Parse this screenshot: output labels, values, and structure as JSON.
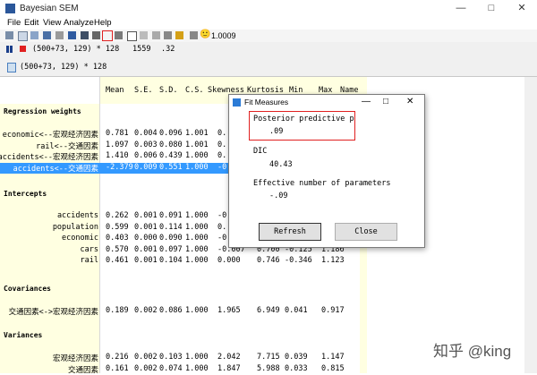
{
  "window": {
    "title": "Bayesian SEM",
    "min": "—",
    "max": "□",
    "close": "✕"
  },
  "menu": [
    "File",
    "Edit",
    "View",
    "Analyze",
    "Help"
  ],
  "toolbar": {
    "smiley": "🙂",
    "convergence": "1.0009"
  },
  "status": {
    "formula": "(500+73, 129) * 128",
    "samples": "1559",
    "rate": ".32"
  },
  "formula2": "(500+73, 129) * 128",
  "columns": [
    "Mean",
    "S.E.",
    "S.D.",
    "C.S.",
    "Skewness",
    "Kurtosis",
    "Min",
    "Max",
    "Name"
  ],
  "sections": {
    "regression": "Regression weights",
    "intercepts": "Intercepts",
    "covariances": "Covariances",
    "variances": "Variances"
  },
  "regression_rows": [
    {
      "label": "economic<--宏观经济因素",
      "vals": [
        "0.781",
        "0.004",
        "0.096",
        "1.001",
        "0.",
        "",
        "",
        ""
      ]
    },
    {
      "label": "rail<--交通因素",
      "vals": [
        "1.097",
        "0.003",
        "0.080",
        "1.001",
        "0.",
        "",
        "",
        ""
      ]
    },
    {
      "label": "accidents<--宏观经济因素",
      "vals": [
        "1.410",
        "0.006",
        "0.439",
        "1.000",
        "0.",
        "",
        "",
        ""
      ]
    },
    {
      "label": "accidents<--交通因素",
      "vals": [
        "-2.379",
        "0.009",
        "0.551",
        "1.000",
        "-0.",
        "",
        "",
        ""
      ]
    }
  ],
  "intercept_rows": [
    {
      "label": "accidents",
      "vals": [
        "0.262",
        "0.001",
        "0.091",
        "1.000",
        "-0.",
        "",
        "",
        ""
      ]
    },
    {
      "label": "population",
      "vals": [
        "0.599",
        "0.001",
        "0.114",
        "1.000",
        "0.",
        "",
        "",
        ""
      ]
    },
    {
      "label": "economic",
      "vals": [
        "0.403",
        "0.000",
        "0.090",
        "1.000",
        "-0.",
        "",
        "",
        ""
      ]
    },
    {
      "label": "cars",
      "vals": [
        "0.570",
        "0.001",
        "0.097",
        "1.000",
        "-0.007",
        "0.700",
        "-0.125",
        "1.186"
      ]
    },
    {
      "label": "rail",
      "vals": [
        "0.461",
        "0.001",
        "0.104",
        "1.000",
        "0.000",
        "0.746",
        "-0.346",
        "1.123"
      ]
    }
  ],
  "covariance_rows": [
    {
      "label": "交通因素<->宏观经济因素",
      "vals": [
        "0.189",
        "0.002",
        "0.086",
        "1.000",
        "1.965",
        "6.949",
        "0.041",
        "0.917"
      ]
    }
  ],
  "variance_rows": [
    {
      "label": "宏观经济因素",
      "vals": [
        "0.216",
        "0.002",
        "0.103",
        "1.000",
        "2.042",
        "7.715",
        "0.039",
        "1.147"
      ]
    },
    {
      "label": "交通因素",
      "vals": [
        "0.161",
        "0.002",
        "0.074",
        "1.000",
        "1.847",
        "5.988",
        "0.033",
        "0.815"
      ]
    }
  ],
  "dialog": {
    "title": "Fit Measures",
    "ppp_label": "Posterior predictive p",
    "ppp_value": ".09",
    "dic_label": "DIC",
    "dic_value": "40.43",
    "enp_label": "Effective number of parameters",
    "enp_value": "-.09",
    "refresh": "Refresh",
    "close": "Close"
  },
  "watermark": "知乎 @king",
  "colors": {
    "selection": "#3399ff",
    "highlight": "#e02020",
    "grid_bg": "#ffffe1"
  }
}
